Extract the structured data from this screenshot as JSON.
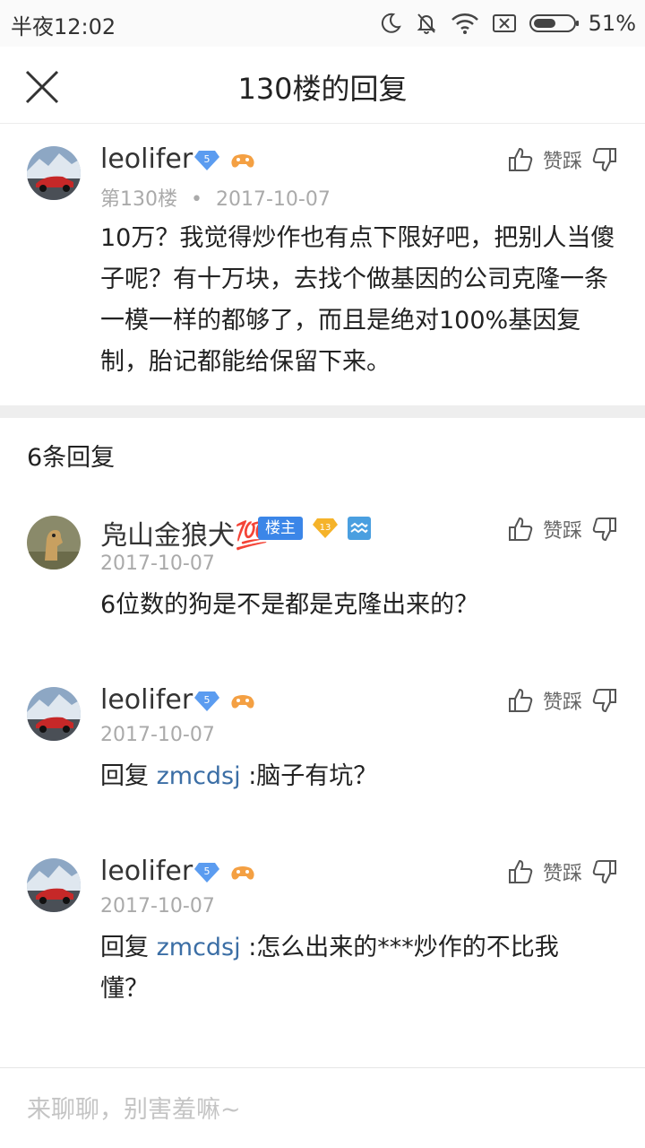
{
  "status_bar": {
    "time": "半夜12:02",
    "battery": "51%",
    "icons": [
      "moon-icon",
      "bell-off-icon",
      "wifi-icon",
      "no-sim-icon",
      "battery-icon"
    ]
  },
  "nav": {
    "title": "130楼的回复",
    "close_icon": "close-icon"
  },
  "main_post": {
    "username": "leolifer",
    "level": "5",
    "floor": "第130楼",
    "dot": "•",
    "date": "2017-10-07",
    "text": "10万？我觉得炒作也有点下限好吧，把别人当傻子呢？有十万块，去找个做基因的公司克隆一条一模一样的都够了，而且是绝对100%基因复制，胎记都能给保留下来。",
    "vote_label": "赞踩"
  },
  "reply_count": "6条回复",
  "replies": [
    {
      "username": "凫山金狼犬💯",
      "owner_badge": "楼主",
      "level": "13",
      "date": "2017-10-07",
      "text": "6位数的狗是不是都是克隆出来的？",
      "vote_label": "赞踩"
    },
    {
      "username": "leolifer",
      "level": "5",
      "date": "2017-10-07",
      "reply_prefix": "回复",
      "reply_to": "zmcdsj",
      "text": " :脑子有坑？",
      "vote_label": "赞踩"
    },
    {
      "username": "leolifer",
      "level": "5",
      "date": "2017-10-07",
      "reply_prefix": "回复",
      "reply_to": "zmcdsj",
      "text": " :怎么出来的***炒作的不比我懂？",
      "vote_label": "赞踩"
    }
  ],
  "input": {
    "placeholder": "来聊聊，别害羞嘛~"
  },
  "colors": {
    "accent_blue": "#3b86e8",
    "link_blue": "#3b6ea5",
    "level_badge": "#f5a623",
    "gray_text": "#aaaaaa"
  }
}
